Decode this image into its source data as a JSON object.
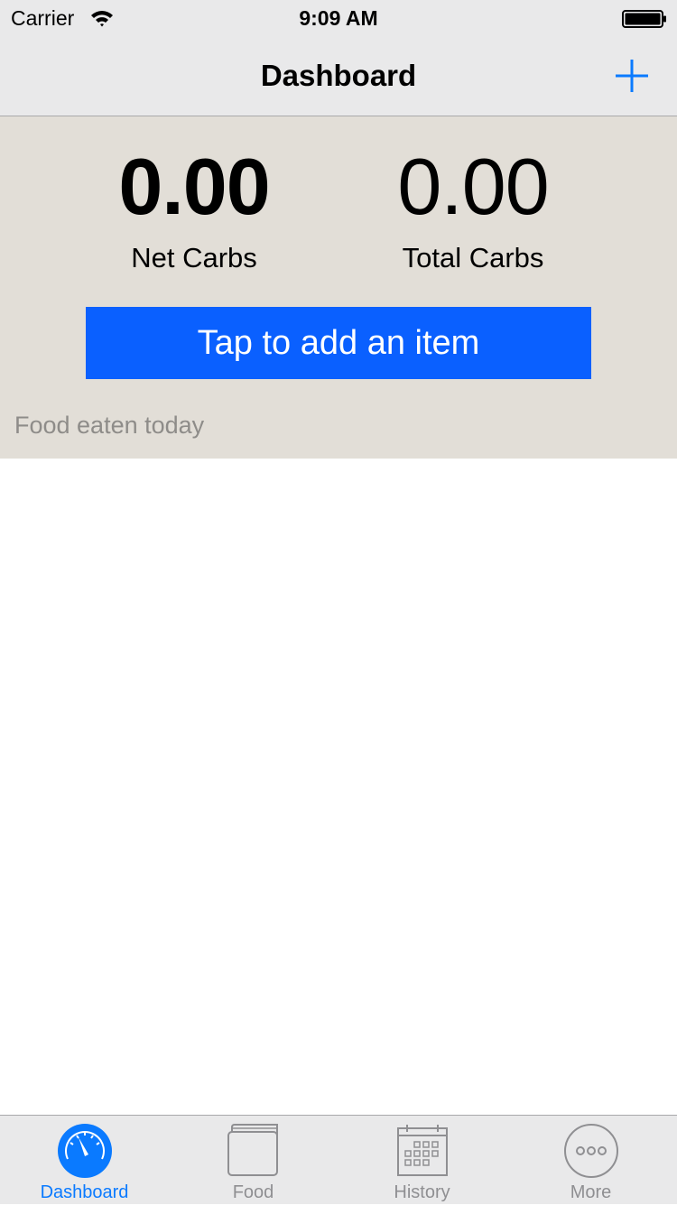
{
  "status_bar": {
    "carrier": "Carrier",
    "time": "9:09 AM",
    "wifi_icon": "wifi-icon",
    "battery_icon": "battery-full-icon"
  },
  "nav": {
    "title": "Dashboard",
    "add_icon": "plus-icon"
  },
  "summary": {
    "net_carbs_value": "0.00",
    "net_carbs_label": "Net Carbs",
    "total_carbs_value": "0.00",
    "total_carbs_label": "Total Carbs",
    "add_item_label": "Tap to add an item",
    "section_label": "Food eaten today"
  },
  "food_items": [],
  "tabs": [
    {
      "label": "Dashboard",
      "icon": "gauge-icon",
      "active": true
    },
    {
      "label": "Food",
      "icon": "book-icon",
      "active": false
    },
    {
      "label": "History",
      "icon": "calendar-icon",
      "active": false
    },
    {
      "label": "More",
      "icon": "more-icon",
      "active": false
    }
  ],
  "colors": {
    "accent": "#0a7aff",
    "cta_background": "#0a60ff",
    "panel_background": "#e2ded7",
    "bar_background": "#e9e9ea",
    "inactive_tab": "#8f8f92"
  }
}
